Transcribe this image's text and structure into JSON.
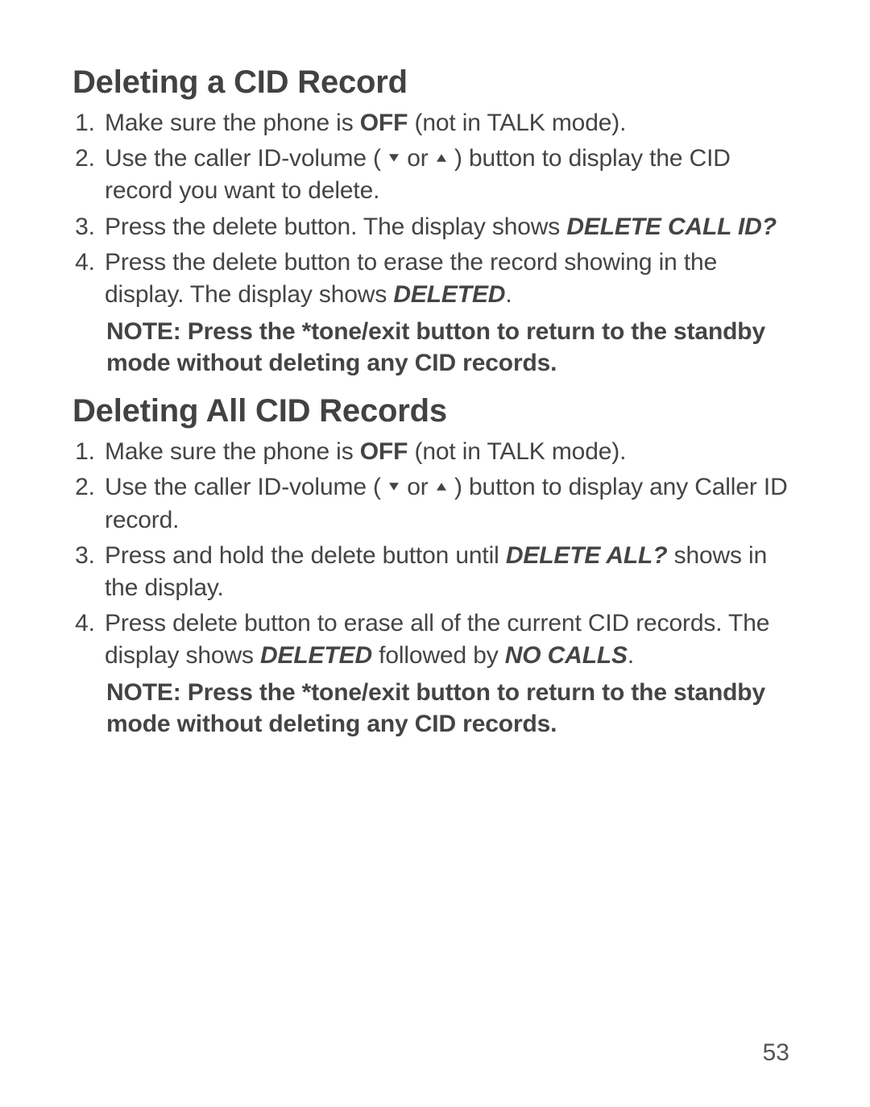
{
  "section1": {
    "heading": "Deleting a CID Record",
    "steps": {
      "s1a": "Make sure the phone is ",
      "s1b": "OFF",
      "s1c": " (not in TALK mode).",
      "s2a": "Use the caller ID-volume (",
      "s2b": " or ",
      "s2c": ") button to display the CID record you want to delete.",
      "s3a": "Press the delete button. The display shows ",
      "s3b": "DELETE CALL ID?",
      "s4a": "Press the delete button to erase the record showing in the display. The display shows ",
      "s4b": "DELETED",
      "s4c": "."
    },
    "note": "NOTE: Press the *tone/exit button to return to the standby mode without deleting any CID records."
  },
  "section2": {
    "heading": "Deleting All CID Records",
    "steps": {
      "s1a": "Make sure the phone is ",
      "s1b": "OFF",
      "s1c": " (not in TALK mode).",
      "s2a": "Use the caller ID-volume (",
      "s2b": " or ",
      "s2c": ") button to display any Caller ID record.",
      "s3a": "Press and hold the delete button until ",
      "s3b": "DELETE ALL?",
      "s3c": " shows in the display.",
      "s4a": "Press delete button to erase all of the current CID records. The display shows ",
      "s4b": "DELETED",
      "s4c": " followed by ",
      "s4d": "NO CALLS",
      "s4e": "."
    },
    "note": "NOTE: Press the *tone/exit button to return to the standby mode without deleting any CID records."
  },
  "page_number": "53"
}
